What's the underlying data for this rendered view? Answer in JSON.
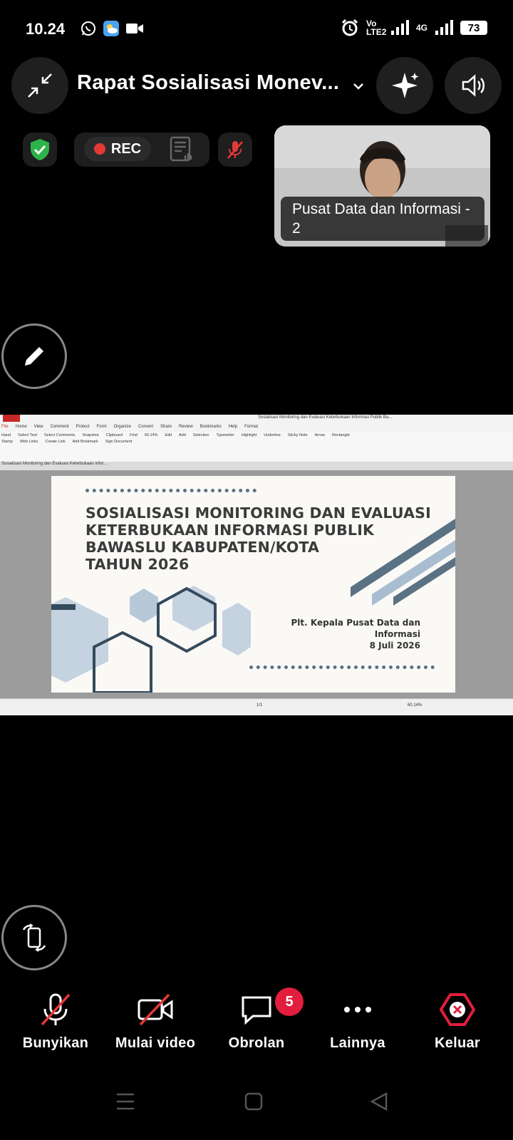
{
  "status_bar": {
    "time": "10.24",
    "network1": "Vo LTE2",
    "network2": "4G",
    "battery": "73"
  },
  "header": {
    "title": "Rapat Sosialisasi Monev...",
    "rec_label": "REC"
  },
  "participant_tile": {
    "name": "Pusat Data dan Informasi - 2"
  },
  "shared_screen": {
    "window_title": "Sosialisasi Monitoring dan Evaluasi Keterbukaan Informasi Publik Ba...",
    "ribbon_tabs": [
      "File",
      "Home",
      "View",
      "Comment",
      "Protect",
      "Form",
      "Organize",
      "Convert",
      "Share",
      "Review",
      "Bookmarks",
      "Help",
      "Format"
    ],
    "ribbon_groups": [
      "Hand",
      "Select Text",
      "Select Comments",
      "Snapshot",
      "Clipboard",
      "Find",
      "Edit",
      "Add",
      "Selection",
      "Typewriter",
      "Highlight",
      "Underline",
      "Sticky Note",
      "Arrow",
      "Rectangle",
      "Stamp",
      "Web Links",
      "Create Link",
      "Add Bookmark",
      "Sign Document"
    ],
    "zoom": "60.14%",
    "doc_tab": "Sosialisasi Monitoring dan Evaluasi Keterbukaan Infor...",
    "slide": {
      "title_lines": [
        "SOSIALISASI MONITORING DAN EVALUASI",
        "KETERBUKAAN INFORMASI PUBLIK",
        "BAWASLU KABUPATEN/KOTA",
        "TAHUN 2026"
      ],
      "presenter": "Plt. Kepala Pusat Data dan Informasi",
      "date": "8 Juli 2026"
    },
    "page_indicator": "1/1",
    "status_zoom": "60.14%"
  },
  "toolbar": {
    "items": [
      {
        "label": "Bunyikan"
      },
      {
        "label": "Mulai video"
      },
      {
        "label": "Obrolan",
        "badge": "5"
      },
      {
        "label": "Lainnya"
      },
      {
        "label": "Keluar"
      }
    ]
  },
  "colors": {
    "badge": "#e21d3d",
    "leave": "#e21d3d",
    "mute_slash": "#e53935",
    "shield": "#2db34a"
  }
}
